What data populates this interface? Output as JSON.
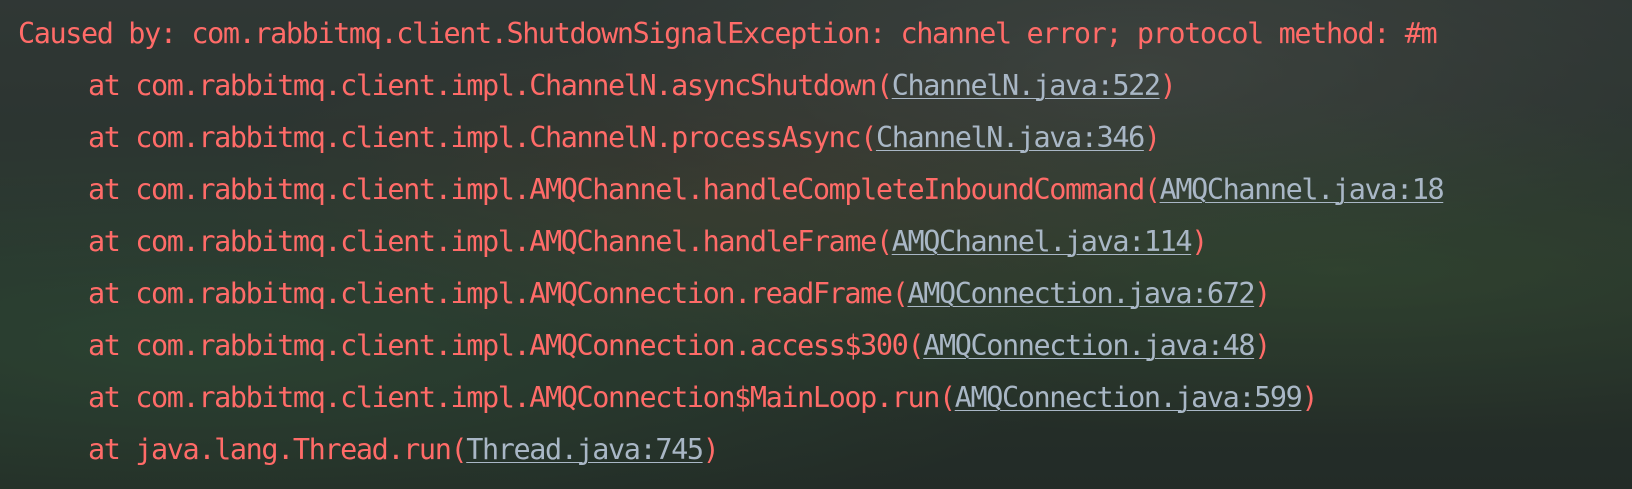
{
  "console": {
    "exception_line": "Caused by: com.rabbitmq.client.ShutdownSignalException: channel error; protocol method: #m",
    "frames": [
      {
        "prefix": "at ",
        "method": "com.rabbitmq.client.impl.ChannelN.asyncShutdown",
        "open": "(",
        "location": "ChannelN.java:522",
        "close": ")"
      },
      {
        "prefix": "at ",
        "method": "com.rabbitmq.client.impl.ChannelN.processAsync",
        "open": "(",
        "location": "ChannelN.java:346",
        "close": ")"
      },
      {
        "prefix": "at ",
        "method": "com.rabbitmq.client.impl.AMQChannel.handleCompleteInboundCommand",
        "open": "(",
        "location": "AMQChannel.java:18",
        "close": ""
      },
      {
        "prefix": "at ",
        "method": "com.rabbitmq.client.impl.AMQChannel.handleFrame",
        "open": "(",
        "location": "AMQChannel.java:114",
        "close": ")"
      },
      {
        "prefix": "at ",
        "method": "com.rabbitmq.client.impl.AMQConnection.readFrame",
        "open": "(",
        "location": "AMQConnection.java:672",
        "close": ")"
      },
      {
        "prefix": "at ",
        "method": "com.rabbitmq.client.impl.AMQConnection.access$300",
        "open": "(",
        "location": "AMQConnection.java:48",
        "close": ")"
      },
      {
        "prefix": "at ",
        "method": "com.rabbitmq.client.impl.AMQConnection$MainLoop.run",
        "open": "(",
        "location": "AMQConnection.java:599",
        "close": ")"
      },
      {
        "prefix": "at ",
        "method": "java.lang.Thread.run",
        "open": "(",
        "location": "Thread.java:745",
        "close": ")"
      }
    ]
  },
  "colors": {
    "error_text": "#ff6b68",
    "link_text": "#a9b7c6"
  }
}
